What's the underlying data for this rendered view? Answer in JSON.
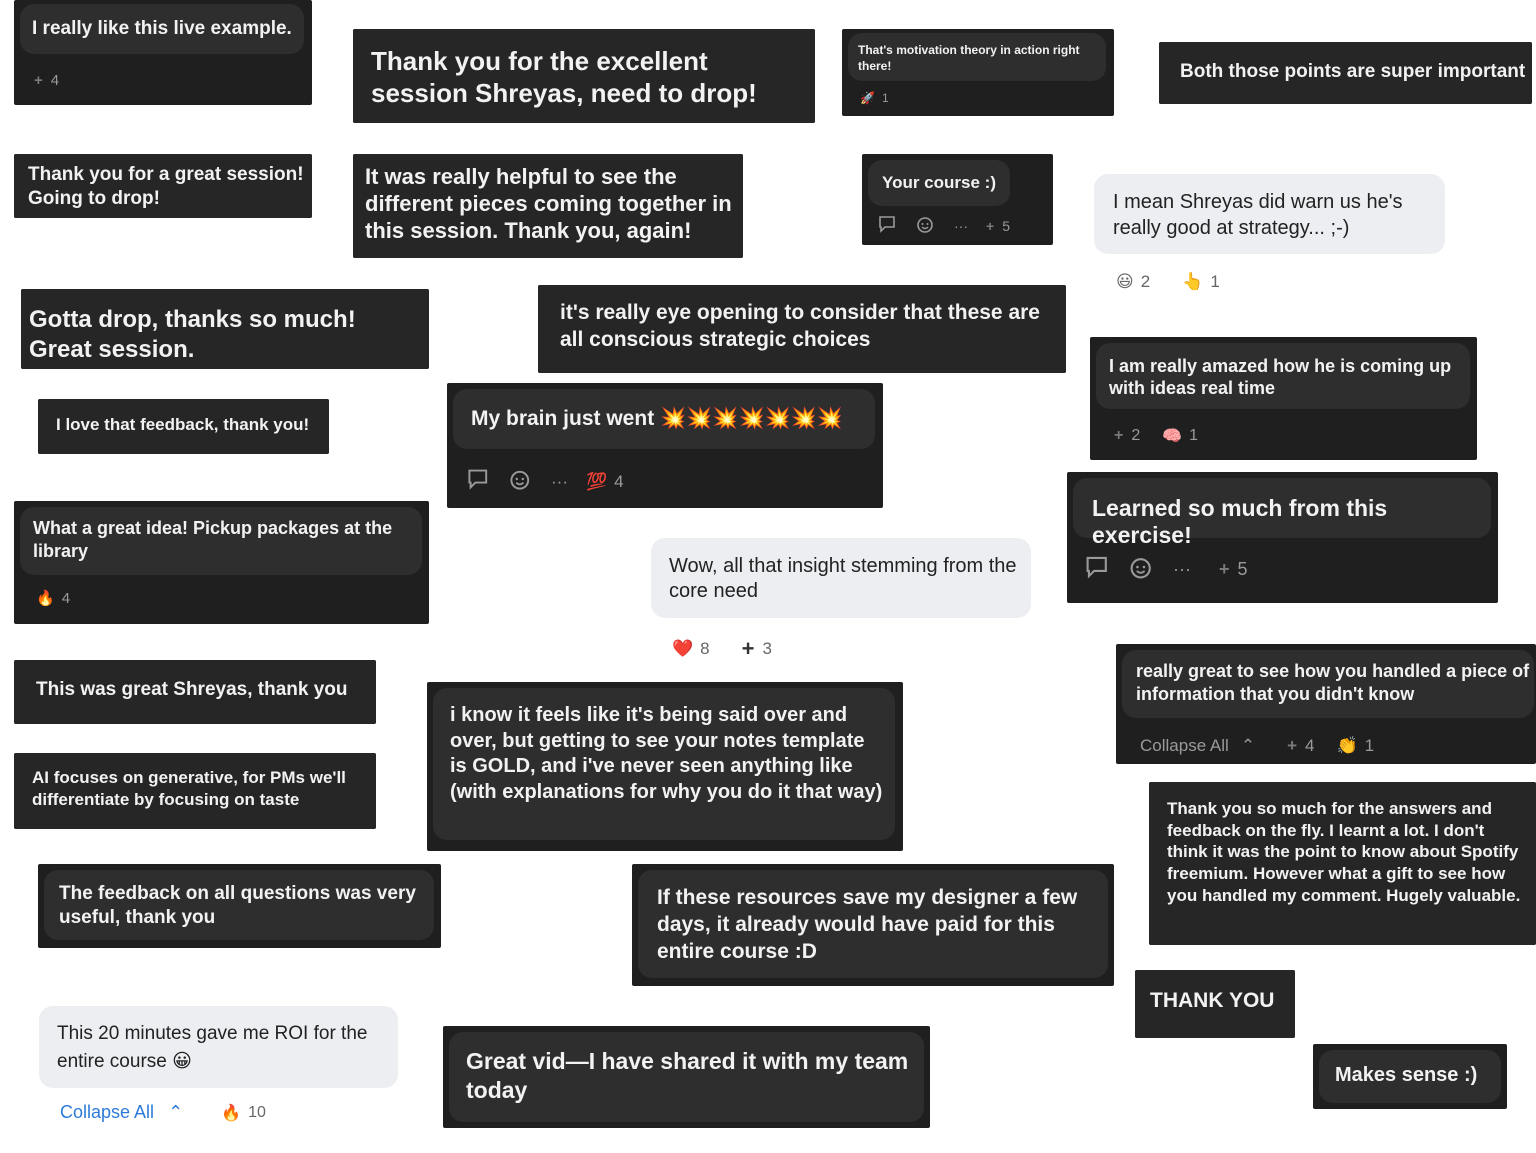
{
  "comments": [
    {
      "text": "I really like this live example.",
      "reaction": "4"
    },
    {
      "text": "Thank you for the excellent session Shreyas, need to drop!"
    },
    {
      "text": "That's motivation theory in action right there!",
      "reaction_emoji": "🚀",
      "reaction": "1"
    },
    {
      "text": "Both those points are super important"
    },
    {
      "text": "Thank you for a great session! Going to drop!"
    },
    {
      "text": "It was really helpful to see the different pieces coming together in this session. Thank you, again!"
    },
    {
      "text": "Your course :)",
      "reaction": "5"
    },
    {
      "text": "I mean Shreyas did warn us he's really good at strategy... ;-)",
      "r1_emoji": "😃",
      "r1": "2",
      "r2_emoji": "👆",
      "r2": "1"
    },
    {
      "text": "Gotta drop, thanks so much! Great session."
    },
    {
      "text": "it's really eye opening to consider that these are all conscious strategic choices"
    },
    {
      "text": "I am really amazed how he is coming up with ideas real time",
      "r1": "2",
      "r2_emoji": "🧠",
      "r2": "1"
    },
    {
      "text": "I love that feedback, thank you!"
    },
    {
      "text": "My brain just went 💥💥💥💥💥💥💥",
      "reaction_emoji": "💯",
      "reaction": "4"
    },
    {
      "text": "Learned so much from this exercise!",
      "reaction": "5"
    },
    {
      "text": "What a great idea! Pickup packages at the library",
      "reaction_emoji": "🔥",
      "reaction": "4"
    },
    {
      "text": "Wow, all that insight stemming from the core need",
      "r1_emoji": "❤️",
      "r1": "8",
      "r2": "3"
    },
    {
      "text": "This was great Shreyas, thank you"
    },
    {
      "text": "really great to see how you handled a piece of information that you didn't know",
      "collapse": "Collapse All",
      "r1": "4",
      "r2_emoji": "👏",
      "r2": "1"
    },
    {
      "text": "i know it feels like it's being said over and over, but getting to see your notes template is GOLD, and i've never seen anything like (with explanations for why you do it that way)"
    },
    {
      "text": "AI focuses on generative, for PMs we'll differentiate by focusing on taste"
    },
    {
      "text": "Thank you so much for the answers and feedback on the fly. I learnt a lot. I don't think it was the point to know about Spotify freemium. However what a gift to see how you handled my comment. Hugely valuable."
    },
    {
      "text": "The feedback on all questions was very useful, thank you"
    },
    {
      "text": "If these resources save my designer a few days, it already would have paid for this entire course :D"
    },
    {
      "text": "THANK YOU"
    },
    {
      "text": "This 20 minutes gave me ROI for the entire course 😀",
      "collapse": "Collapse All",
      "reaction_emoji": "🔥",
      "reaction": "10"
    },
    {
      "text": "Great vid—I have shared it with my team today"
    },
    {
      "text": "Makes sense :)"
    }
  ],
  "icons": {
    "plus": "+",
    "chevron": "⌃",
    "more": "···",
    "reply": "reply-icon",
    "add_reaction": "add-reaction-icon"
  }
}
